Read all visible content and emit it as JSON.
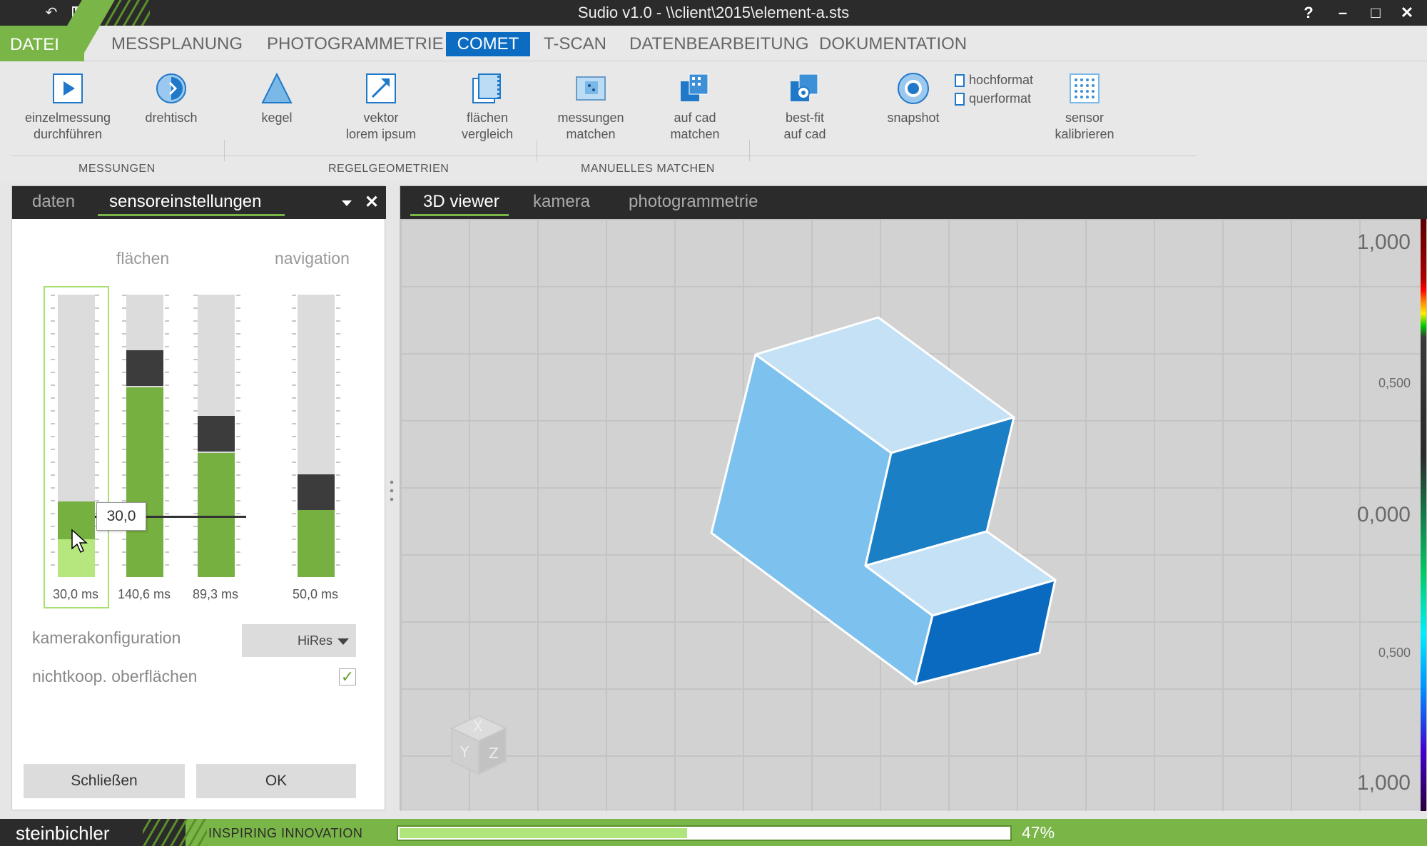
{
  "window": {
    "title": "Sudio v1.0 - \\\\client\\2015\\element-a.sts",
    "help": "?",
    "minimize": "–",
    "maximize": "□",
    "close": "✕"
  },
  "menu": {
    "datei": "DATEI",
    "items": [
      "MESSPLANUNG",
      "PHOTOGRAMMETRIE",
      "COMET",
      "T-SCAN",
      "DATENBEARBEITUNG",
      "DOKUMENTATION"
    ],
    "active": "COMET"
  },
  "ribbon": {
    "buttons": [
      {
        "label1": "einzelmessung",
        "label2": "durchführen",
        "icon": "play-icon"
      },
      {
        "label1": "drehtisch",
        "label2": "",
        "icon": "turntable-icon"
      },
      {
        "label1": "kegel",
        "label2": "",
        "icon": "cone-icon"
      },
      {
        "label1": "vektor",
        "label2": "lorem ipsum",
        "icon": "vector-arrow-icon"
      },
      {
        "label1": "flächen",
        "label2": "vergleich",
        "icon": "surface-compare-icon"
      },
      {
        "label1": "messungen",
        "label2": "matchen",
        "icon": "match-measurements-icon"
      },
      {
        "label1": "auf cad",
        "label2": "matchen",
        "icon": "cad-match-icon"
      },
      {
        "label1": "best-fit",
        "label2": "auf cad",
        "icon": "best-fit-icon"
      },
      {
        "label1": "snapshot",
        "label2": "",
        "icon": "camera-shutter-icon"
      },
      {
        "label1": "sensor",
        "label2": "kalibrieren",
        "icon": "calibration-grid-icon"
      }
    ],
    "format_options": [
      "hochformat",
      "querformat"
    ],
    "groups": [
      "MESSUNGEN",
      "REGELGEOMETRIEN",
      "MANUELLES MATCHEN"
    ]
  },
  "left_panel": {
    "tabs": [
      "daten",
      "sensoreinstellungen"
    ],
    "active_tab": "sensoreinstellungen",
    "section_flaechen": "flächen",
    "section_navigation": "navigation",
    "sliders": [
      {
        "value_label": "30,0 ms",
        "level_fraction": 0.27
      },
      {
        "value_label": "140,6 ms",
        "level_fraction": 0.68
      },
      {
        "value_label": "89,3 ms",
        "level_fraction": 0.44
      },
      {
        "value_label": "50,0 ms",
        "level_fraction": 0.24
      }
    ],
    "tooltip_value": "30,0",
    "camera_config_label": "kamerakonfiguration",
    "camera_config_value": "HiRes",
    "noncoop_label": "nichtkoop. oberflächen",
    "noncoop_checked": true,
    "close_button": "Schließen",
    "ok_button": "OK"
  },
  "viewer": {
    "tabs": [
      "3D viewer",
      "kamera",
      "photogrammetrie"
    ],
    "active_tab": "3D viewer",
    "scale_labels": [
      "1,000",
      "0,500",
      "0,000",
      "0,500",
      "1,000"
    ],
    "axis_cube_labels": [
      "Y",
      "X",
      "Z"
    ]
  },
  "status": {
    "brand": "steinbichler",
    "tagline": "INSPIRING INNOVATION",
    "progress_percent": 47,
    "progress_label": "47%"
  },
  "colors": {
    "accent_green": "#7ab547",
    "accent_blue": "#0b6cc2",
    "dark_bar": "#2b2b2b"
  }
}
